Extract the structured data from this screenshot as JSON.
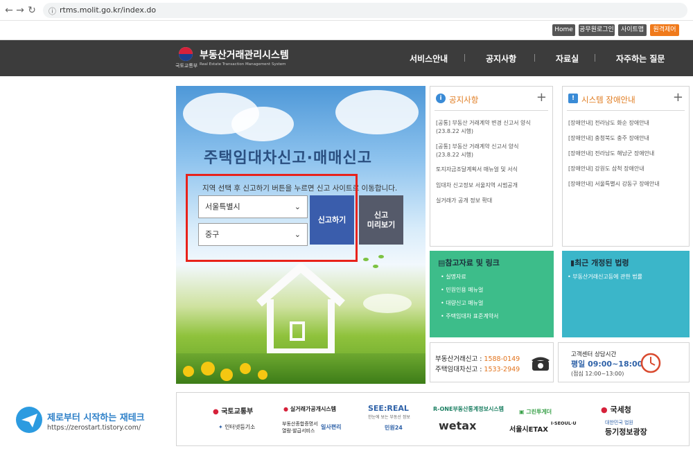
{
  "browser": {
    "url": "rtms.molit.go.kr/index.do"
  },
  "utility": {
    "home": "Home",
    "official_login": "공무원로그인",
    "sitemap": "사이트맵",
    "remote": "원격제어"
  },
  "header": {
    "ministry": "국토교통부",
    "title": "부동산거래관리시스템",
    "subtitle_en": "Real Estate Transaction Management System",
    "menu": [
      "서비스안내",
      "공지사항",
      "자료실",
      "자주하는 질문"
    ]
  },
  "hero": {
    "title": "주택임대차신고·매매신고",
    "description": "지역 선택 후 신고하기 버튼을 누르면 신고 사이트로 이동합니다.",
    "select_region": "서울특별시",
    "select_district": "중구",
    "report_button": "신고하기",
    "preview_button_line1": "신고",
    "preview_button_line2": "미리보기"
  },
  "notice": {
    "title": "공지사항",
    "items": [
      "[공통] 부동산 거래계약 변경 신고서 양식",
      "(23.8.22 시행)",
      "[공통] 부동산 거래계약 신고서 양식",
      "(23.8.22 시행)",
      "토지자금조달계획서 매뉴얼 및 서식",
      "임대차 신고정보 서울지역 시범공개",
      "실거래가 공개 정보 확대"
    ]
  },
  "outage": {
    "title": "시스템 장애안내",
    "items": [
      "[장애안내] 전라남도 화순 장애안내",
      "[장애안내] 충청북도 충주 장애안내",
      "[장애안내] 전라남도 해남군 장애안내",
      "[장애안내] 강원도 삼척 장애안내",
      "[장애안내] 서울특별시 강동구 장애안내"
    ]
  },
  "references": {
    "title": "참고자료 및 링크",
    "items": [
      "실명자료",
      "민원인용 매뉴얼",
      "대량신고 매뉴얼",
      "주택임대차 표준계약서"
    ]
  },
  "laws": {
    "title": "최근 개정된 법령",
    "items": [
      "부동산거래신고등에 관한 법률"
    ]
  },
  "contact": {
    "line1_label": "부동산거래신고 : ",
    "line1_number": "1588-0149",
    "line2_label": "주택임대차신고 : ",
    "line2_number": "1533-2949"
  },
  "center": {
    "title": "고객센터 상담시간",
    "hours": "평일 09:00~18:00",
    "lunch": "(점심 12:00~13:00)"
  },
  "links": {
    "molit": "국토교통부",
    "realprice": "실거래가공개시스템",
    "seereal": "SEE:REAL",
    "seereal_sub": "한눈에 보는 부동산 정보",
    "rone": "R-ONE부동산통계정보시스템",
    "greenbook": "그린투게더",
    "nts": "국세청",
    "court": "대한민국 법원",
    "registry": "등기정보광장",
    "internet_registry": "인터넷등기소",
    "docs_service_1": "부동산종합증명서",
    "docs_service_2": "열람·발급서비스",
    "ilsa": "일사편리",
    "minwon24": "민원24",
    "wetax": "wetax",
    "etax": "서울시ETAX",
    "iseoul": "I·SEOUL·U"
  },
  "watermark": {
    "title": "제로부터 시작하는 재테크",
    "url": "https://zerostart.tistory.com/"
  }
}
